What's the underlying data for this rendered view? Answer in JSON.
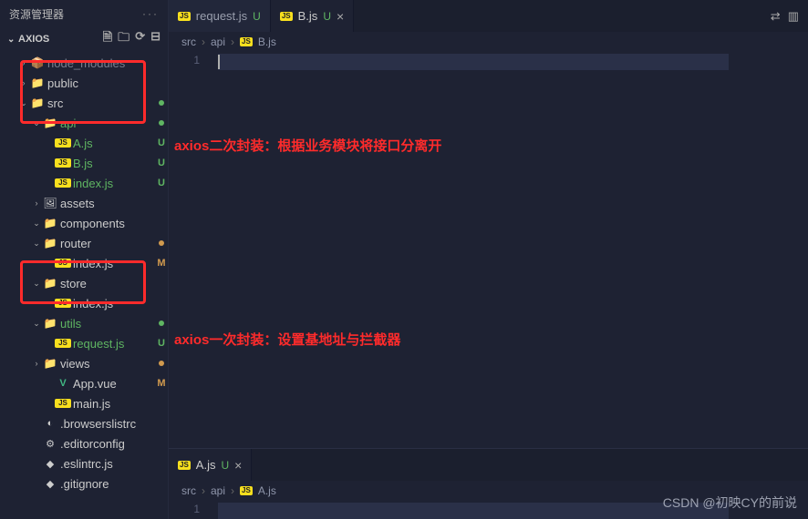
{
  "sidebar": {
    "title": "资源管理器",
    "project": "AXIOS",
    "items": [
      {
        "chev": "›",
        "icon": "📦",
        "iconClass": "folder-green",
        "name": "node_modules",
        "nameClass": "dim",
        "status": "",
        "indent": 20
      },
      {
        "chev": "›",
        "icon": "📁",
        "iconClass": "folder-green",
        "name": "public",
        "nameClass": "",
        "status": "",
        "indent": 20
      },
      {
        "chev": "⌄",
        "icon": "📁",
        "iconClass": "folder-green",
        "name": "src",
        "nameClass": "",
        "status": "●",
        "statusClass": "u",
        "indent": 20
      },
      {
        "chev": "⌄",
        "icon": "📁",
        "iconClass": "folder-green",
        "name": "api",
        "nameClass": "green-text",
        "status": "●",
        "statusClass": "u",
        "indent": 34,
        "boxStart": true
      },
      {
        "chev": "",
        "icon": "JS",
        "iconClass": "js-icon",
        "name": "A.js",
        "nameClass": "green-text",
        "status": "U",
        "statusClass": "u",
        "indent": 48
      },
      {
        "chev": "",
        "icon": "JS",
        "iconClass": "js-icon",
        "name": "B.js",
        "nameClass": "green-text",
        "status": "U",
        "statusClass": "u",
        "indent": 48,
        "boxEnd": true
      },
      {
        "chev": "",
        "icon": "JS",
        "iconClass": "js-icon",
        "name": "index.js",
        "nameClass": "green-text",
        "status": "U",
        "statusClass": "u",
        "indent": 48
      },
      {
        "chev": "›",
        "icon": "🖼",
        "iconClass": "",
        "name": "assets",
        "nameClass": "",
        "status": "",
        "indent": 34
      },
      {
        "chev": "⌄",
        "icon": "📁",
        "iconClass": "folder-yellow",
        "name": "components",
        "nameClass": "",
        "status": "",
        "indent": 34
      },
      {
        "chev": "⌄",
        "icon": "📁",
        "iconClass": "folder-green",
        "name": "router",
        "nameClass": "",
        "status": "●",
        "statusClass": "m",
        "indent": 34
      },
      {
        "chev": "",
        "icon": "JS",
        "iconClass": "js-icon",
        "name": "index.js",
        "nameClass": "",
        "status": "M",
        "statusClass": "m",
        "indent": 48
      },
      {
        "chev": "⌄",
        "icon": "📁",
        "iconClass": "folder-dark",
        "name": "store",
        "nameClass": "",
        "status": "",
        "indent": 34
      },
      {
        "chev": "",
        "icon": "JS",
        "iconClass": "js-icon",
        "name": "index.js",
        "nameClass": "",
        "status": "",
        "indent": 48
      },
      {
        "chev": "⌄",
        "icon": "📁",
        "iconClass": "folder-yellow",
        "name": "utils",
        "nameClass": "green-text",
        "status": "●",
        "statusClass": "u",
        "indent": 34,
        "box2Start": true
      },
      {
        "chev": "",
        "icon": "JS",
        "iconClass": "js-icon",
        "name": "request.js",
        "nameClass": "green-text",
        "status": "U",
        "statusClass": "u",
        "indent": 48,
        "box2End": true
      },
      {
        "chev": "›",
        "icon": "📁",
        "iconClass": "",
        "name": "views",
        "nameClass": "",
        "status": "●",
        "statusClass": "m",
        "indent": 34
      },
      {
        "chev": "",
        "icon": "V",
        "iconClass": "vue-icon",
        "name": "App.vue",
        "nameClass": "",
        "status": "M",
        "statusClass": "m",
        "indent": 48
      },
      {
        "chev": "",
        "icon": "JS",
        "iconClass": "js-icon",
        "name": "main.js",
        "nameClass": "",
        "status": "",
        "indent": 48
      },
      {
        "chev": "",
        "icon": "◐",
        "iconClass": "browsers-icon",
        "name": ".browserslistrc",
        "nameClass": "",
        "status": "",
        "indent": 34
      },
      {
        "chev": "",
        "icon": "⚙",
        "iconClass": "gear-icon",
        "name": ".editorconfig",
        "nameClass": "",
        "status": "",
        "indent": 34
      },
      {
        "chev": "",
        "icon": "◆",
        "iconClass": "eslint-icon",
        "name": ".eslintrc.js",
        "nameClass": "",
        "status": "",
        "indent": 34
      },
      {
        "chev": "",
        "icon": "◆",
        "iconClass": "git-icon",
        "name": ".gitignore",
        "nameClass": "",
        "status": "",
        "indent": 34
      }
    ]
  },
  "pane1": {
    "tabs": [
      {
        "icon": "JS",
        "name": "request.js",
        "status": "U",
        "active": false
      },
      {
        "icon": "JS",
        "name": "B.js",
        "status": "U",
        "active": true
      }
    ],
    "breadcrumb": [
      "src",
      "api",
      "B.js"
    ],
    "lineNum": "1",
    "annotation": "axios二次封装：根据业务模块将接口分离开"
  },
  "pane2": {
    "tabs": [
      {
        "icon": "JS",
        "name": "A.js",
        "status": "U",
        "active": true
      }
    ],
    "breadcrumb": [
      "src",
      "api",
      "A.js"
    ],
    "lineNum": "1",
    "annotation": "axios一次封装：设置基地址与拦截器"
  },
  "watermark": "CSDN @初映CY的前说"
}
